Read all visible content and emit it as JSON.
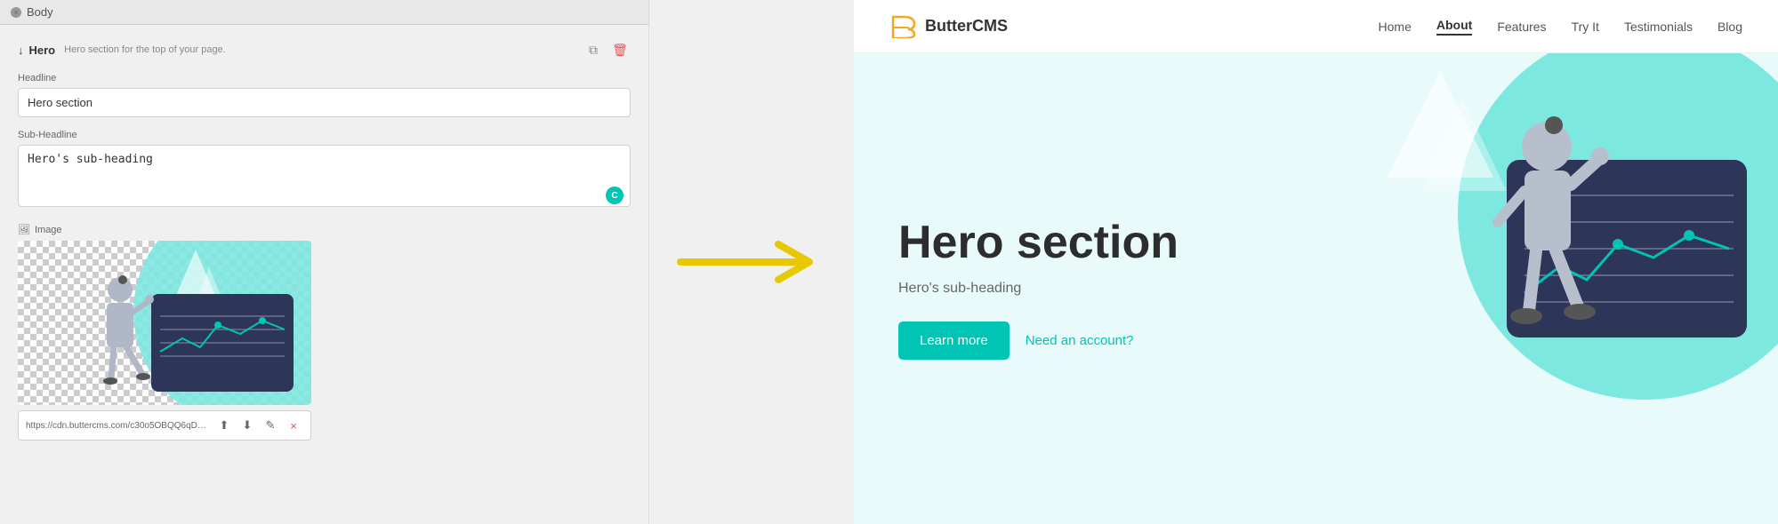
{
  "topbar": {
    "label": "Body",
    "close": "×"
  },
  "editor": {
    "hero_label": "Hero",
    "hero_desc": "Hero section for the top of your page.",
    "headline_label": "Headline",
    "headline_value": "Hero section",
    "subheadline_label": "Sub-Headline",
    "subheadline_value": "Hero's sub-heading",
    "image_label": "Image",
    "image_url": "https://cdn.buttercms.com/c30o5OBQQ6qD4ml09M9ll",
    "copy_icon": "⧉",
    "delete_icon": "🗑",
    "upload_icon": "⬆",
    "download_icon": "⬇",
    "edit_icon": "✎",
    "close_icon": "×"
  },
  "preview": {
    "logo_text": "ButterCMS",
    "nav_items": [
      {
        "label": "Home",
        "active": false
      },
      {
        "label": "About",
        "active": true
      },
      {
        "label": "Features",
        "active": false
      },
      {
        "label": "Try It",
        "active": false
      },
      {
        "label": "Testimonials",
        "active": false
      },
      {
        "label": "Blog",
        "active": false
      }
    ],
    "hero_title": "Hero section",
    "hero_subtitle": "Hero's sub-heading",
    "btn_learn_more": "Learn more",
    "btn_account": "Need an account?",
    "colors": {
      "teal": "#7de8e0",
      "dark_nav": "#2d3558",
      "accent": "#00c4b4"
    }
  }
}
